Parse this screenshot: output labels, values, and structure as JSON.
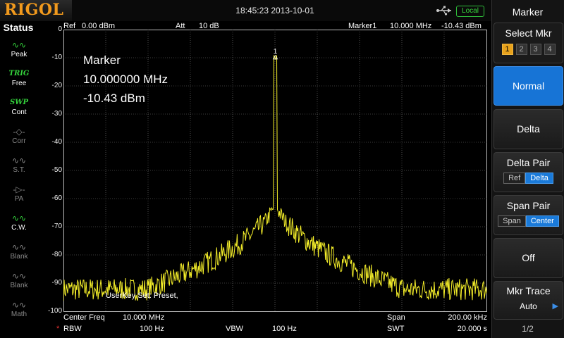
{
  "header": {
    "brand": "RIGOL",
    "datetime": "18:45:23 2013-10-01",
    "local_label": "Local",
    "usb_icon": "usb-icon"
  },
  "status": {
    "title": "Status",
    "items": [
      {
        "name": "peak",
        "icon": "peak-icon",
        "label": "Peak",
        "active": true
      },
      {
        "name": "trig",
        "top": "TRIG",
        "label": "Free",
        "active": true
      },
      {
        "name": "swp",
        "top": "SWP",
        "label": "Cont",
        "active": true
      },
      {
        "name": "corr",
        "icon": "corr-icon",
        "label": "Corr",
        "active": false
      },
      {
        "name": "st",
        "icon": "st-icon",
        "label": "S.T.",
        "active": false
      },
      {
        "name": "pa",
        "icon": "pa-icon",
        "label": "PA",
        "active": false
      },
      {
        "name": "cw",
        "icon": "cw-icon",
        "label": "C.W.",
        "active": true
      },
      {
        "name": "blank1",
        "icon": "blank-icon",
        "label": "Blank",
        "active": false
      },
      {
        "name": "blank2",
        "icon": "blank-icon",
        "label": "Blank",
        "active": false
      },
      {
        "name": "math",
        "icon": "math-icon",
        "label": "Math",
        "active": false
      }
    ]
  },
  "display": {
    "ref_label": "Ref",
    "ref_value": "0.00 dBm",
    "att_label": "Att",
    "att_value": "10 dB",
    "marker_label": "Marker1",
    "marker_freq": "10.000 MHz",
    "marker_level": "-10.43 dBm",
    "marker_box": {
      "title": "Marker",
      "freq": "10.000000 MHz",
      "level": "-10.43 dBm"
    },
    "marker_flag": "1",
    "userkey_text": "UserKey Set:   Preset,",
    "y_labels": [
      "0",
      "-10",
      "-20",
      "-30",
      "-40",
      "-50",
      "-60",
      "-70",
      "-80",
      "-90",
      "-100"
    ],
    "trace_color": "#f5ef2a"
  },
  "chart_data": {
    "type": "line",
    "ylim": [
      -100,
      0
    ],
    "x_center_mhz": 10.0,
    "x_span_khz": 200.0,
    "peak": {
      "x_mhz": 10.0,
      "y_dbm": -10.43
    }
  },
  "bottom": {
    "center_label": "Center Freq",
    "center_value": "10.000 MHz",
    "span_label": "Span",
    "span_value": "200.00 kHz",
    "rbw_star": "*",
    "rbw_label": "RBW",
    "rbw_value": "100 Hz",
    "vbw_label": "VBW",
    "vbw_value": "100 Hz",
    "swt_label": "SWT",
    "swt_value": "20.000 s"
  },
  "menu": {
    "title": "Marker",
    "select_mkr": {
      "label": "Select Mkr",
      "options": [
        "1",
        "2",
        "3",
        "4"
      ],
      "selected": "1"
    },
    "normal": "Normal",
    "delta": "Delta",
    "delta_pair": {
      "label": "Delta Pair",
      "options": [
        "Ref",
        "Delta"
      ],
      "selected": "Delta"
    },
    "span_pair": {
      "label": "Span Pair",
      "options": [
        "Span",
        "Center"
      ],
      "selected": "Center"
    },
    "off": "Off",
    "mkr_trace": {
      "label": "Mkr Trace",
      "value": "Auto"
    },
    "page": "1/2"
  }
}
